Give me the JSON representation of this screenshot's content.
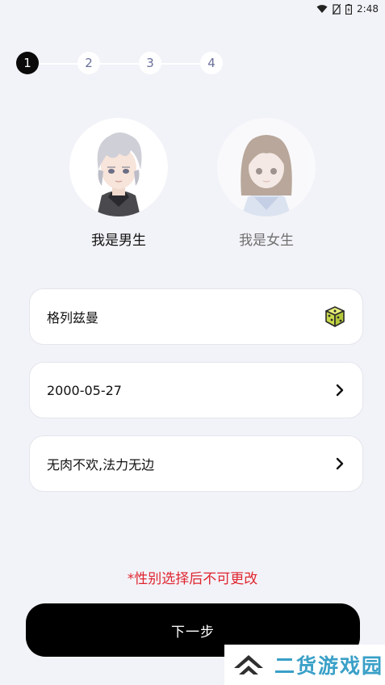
{
  "status_bar": {
    "time": "2:48"
  },
  "stepper": {
    "steps": [
      "1",
      "2",
      "3",
      "4"
    ],
    "active_index": 0
  },
  "gender": {
    "male_label": "我是男生",
    "female_label": "我是女生",
    "selected": "male"
  },
  "form": {
    "nickname": "格列兹曼",
    "birthday": "2000-05-27",
    "signature": "无肉不欢,法力无边"
  },
  "warning_text": "*性别选择后不可更改",
  "next_button_label": "下一步",
  "watermark_text": "二货游戏园",
  "colors": {
    "background": "#f2f3f8",
    "accent": "#000000",
    "warning": "#e0242f",
    "step_inactive_text": "#6a6f99",
    "watermark_blue": "#3aa0c8"
  },
  "icons": {
    "nickname_random": "dice-icon",
    "birthday_arrow": "chevron-right-icon",
    "signature_arrow": "chevron-right-icon"
  }
}
